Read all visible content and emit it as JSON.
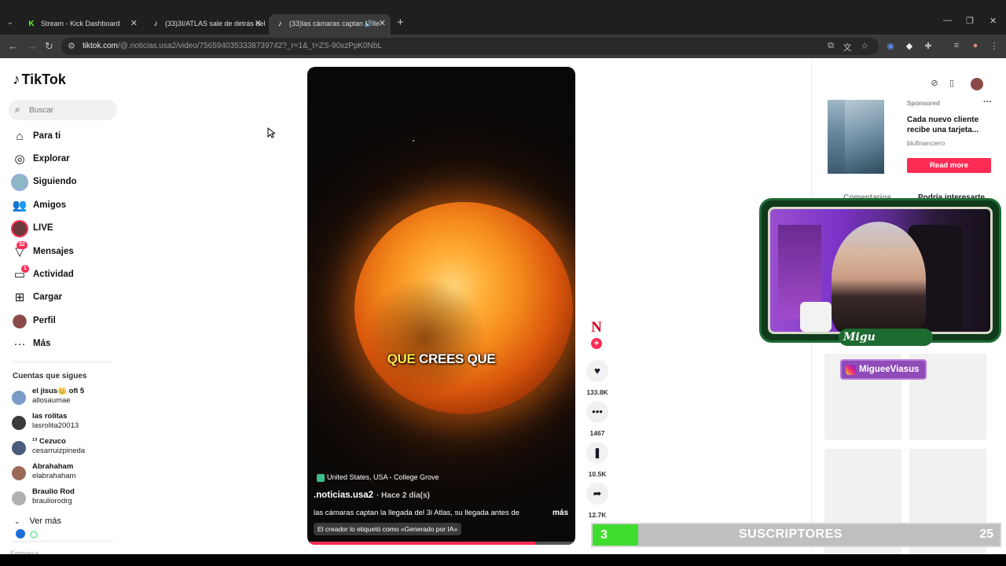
{
  "browser": {
    "tabs": [
      {
        "title": "Stream - Kick Dashboard",
        "favicon": "kick-icon"
      },
      {
        "title": "(33)3I/ATLAS sale de detrás del",
        "favicon": "tiktok-icon"
      },
      {
        "title": "(33)las cámaras captan la lle",
        "favicon": "tiktok-icon",
        "active": true
      }
    ],
    "url_host": "tiktok.com",
    "url_path": "/@.noticias.usa2/video/7565940353338739742?_r=1&_t=ZS-90xzPpK0NbL"
  },
  "sidebar": {
    "logo": "TikTok",
    "search_placeholder": "Buscar",
    "nav": [
      {
        "label": "Para ti",
        "icon": "home-icon"
      },
      {
        "label": "Explorar",
        "icon": "compass-icon"
      },
      {
        "label": "Siguiendo",
        "icon": "following-avatar-icon"
      },
      {
        "label": "Amigos",
        "icon": "friends-icon"
      },
      {
        "label": "LIVE",
        "icon": "live-icon"
      },
      {
        "label": "Mensajes",
        "icon": "messages-icon",
        "badge": "32"
      },
      {
        "label": "Actividad",
        "icon": "activity-icon",
        "badge": "1"
      },
      {
        "label": "Cargar",
        "icon": "upload-icon"
      },
      {
        "label": "Perfil",
        "icon": "profile-avatar-icon"
      },
      {
        "label": "Más",
        "icon": "more-icon"
      }
    ],
    "following_title": "Cuentas que sigues",
    "following": [
      {
        "name": "el jisus👑 ofi 5",
        "handle": "allosaumae",
        "color": "#7a9cc6"
      },
      {
        "name": "las rolitas",
        "handle": "lasrolita20013",
        "color": "#3a3a3a"
      },
      {
        "name": "¹³ Cezuco",
        "handle": "cesarruizpineda",
        "color": "#4a5c7a"
      },
      {
        "name": "Abrahaham",
        "handle": "elabrahaham",
        "color": "#9a6a5a"
      },
      {
        "name": "Braulio Rod",
        "handle": "brauliorodrg",
        "color": "#b0b0b0"
      }
    ],
    "see_more": "Ver más",
    "truncated": "Empresa"
  },
  "video": {
    "caption_word1": "QUE",
    "caption_word2": "CREES QUE",
    "location": "United States, USA - College Grove",
    "author": ".noticias.usa2",
    "posted": "· Hace 2 día(s)",
    "description": "las cámaras captan la llegada del 3i Atlas, su llegada antes de",
    "more": "más",
    "ai_label": "El creador lo etiquetó como «Generado por IA»",
    "progress": 0.85
  },
  "actions": {
    "creator_initial": "N",
    "likes": "133.8K",
    "comments": "1467",
    "saves": "10.5K",
    "shares": "12.7K"
  },
  "right_panel": {
    "sponsored": "Sponsored",
    "ad_title": "Cada nuevo cliente recibe una tarjeta...",
    "ad_brand": "blufinanciero",
    "ad_cta": "Read more",
    "tab_comments": "Comentarios",
    "tab_related": "Podría interesarte"
  },
  "stream_overlay": {
    "cam_name": "Migu",
    "instagram": "MigueeViasus",
    "subs_current": "3",
    "subs_label": "SUSCRIPTORES",
    "subs_goal": "25"
  },
  "colors": {
    "tiktok_red": "#fe2c55",
    "overlay_green": "#3fdd2d"
  }
}
